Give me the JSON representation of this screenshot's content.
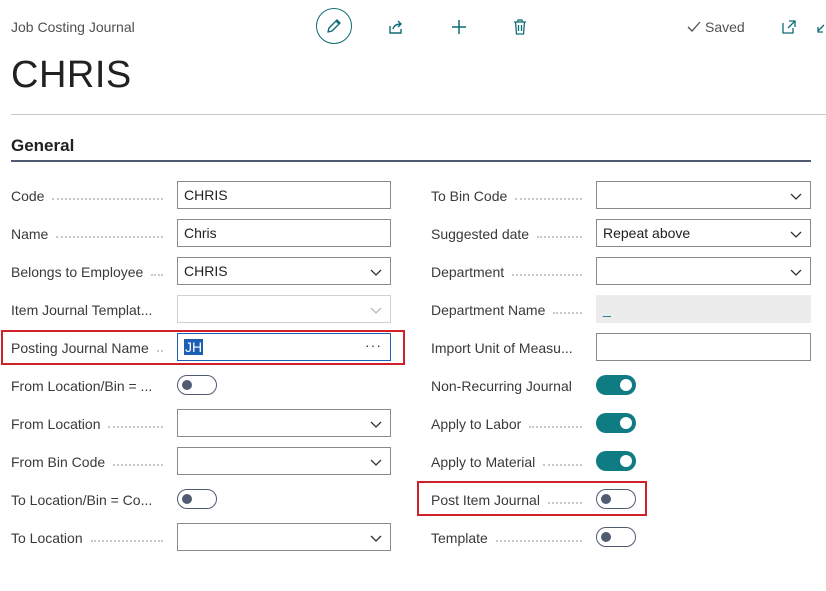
{
  "header": {
    "breadcrumb": "Job Costing Journal",
    "saved_label": "Saved",
    "page_title": "CHRIS"
  },
  "section": {
    "title": "General"
  },
  "left_fields": {
    "code": {
      "label": "Code",
      "value": "CHRIS"
    },
    "name": {
      "label": "Name",
      "value": "Chris"
    },
    "belongs": {
      "label": "Belongs to Employee",
      "value": "CHRIS"
    },
    "item_tmpl": {
      "label": "Item Journal Templat...",
      "value": ""
    },
    "posting": {
      "label": "Posting Journal Name",
      "value": "JH",
      "more": "···"
    },
    "from_loc_bin": {
      "label": "From Location/Bin = ...",
      "toggle": false
    },
    "from_loc": {
      "label": "From Location",
      "value": ""
    },
    "from_bin": {
      "label": "From Bin Code",
      "value": ""
    },
    "to_loc_bin": {
      "label": "To Location/Bin = Co...",
      "toggle": false
    },
    "to_loc": {
      "label": "To Location",
      "value": ""
    }
  },
  "right_fields": {
    "to_bin": {
      "label": "To Bin Code",
      "value": ""
    },
    "suggested": {
      "label": "Suggested date",
      "value": "Repeat above"
    },
    "department": {
      "label": "Department",
      "value": ""
    },
    "dept_name": {
      "label": "Department Name",
      "value": "_"
    },
    "import_uom": {
      "label": "Import Unit of Measu...",
      "value": ""
    },
    "non_recurring": {
      "label": "Non-Recurring Journal",
      "toggle": true
    },
    "apply_labor": {
      "label": "Apply to Labor",
      "toggle": true
    },
    "apply_material": {
      "label": "Apply to Material",
      "toggle": true
    },
    "post_item": {
      "label": "Post Item Journal",
      "toggle": false
    },
    "template": {
      "label": "Template",
      "toggle": false
    }
  },
  "colors": {
    "accent": "#0f7b83",
    "highlight": "#d0202a",
    "section_rule": "#505a70"
  },
  "icons": [
    "edit-icon",
    "share-icon",
    "add-icon",
    "delete-icon",
    "checkmark-icon",
    "open-in-new-icon",
    "collapse-icon",
    "chevron-down-icon"
  ]
}
